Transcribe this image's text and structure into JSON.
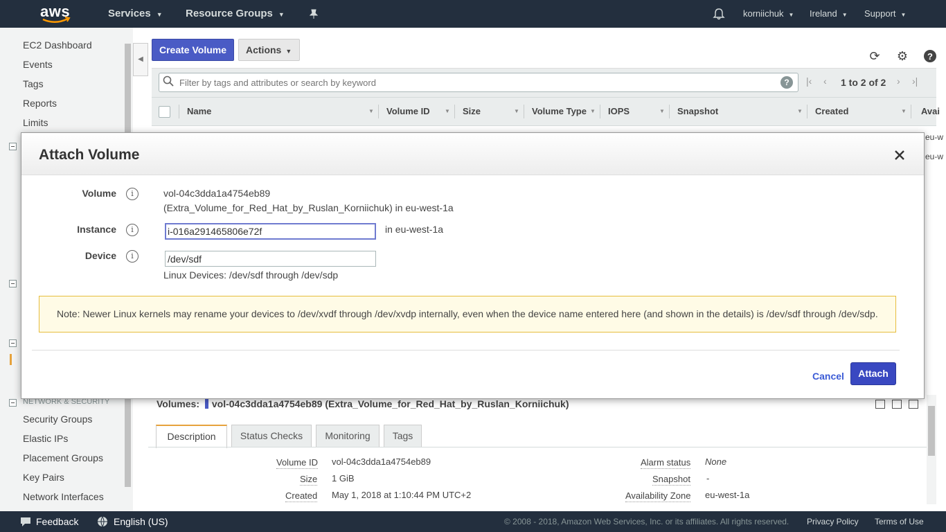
{
  "topnav": {
    "logo": "aws",
    "services": "Services",
    "resource_groups": "Resource Groups",
    "user": "korniichuk",
    "region": "Ireland",
    "support": "Support"
  },
  "sidebar": {
    "items_top": [
      "EC2 Dashboard",
      "Events",
      "Tags",
      "Reports",
      "Limits"
    ],
    "network_section": "NETWORK & SECURITY",
    "network_items": [
      "Security Groups",
      "Elastic IPs",
      "Placement Groups",
      "Key Pairs",
      "Network Interfaces"
    ]
  },
  "toolbar": {
    "create_label": "Create Volume",
    "actions_label": "Actions"
  },
  "filter": {
    "placeholder": "Filter by tags and attributes or search by keyword",
    "pager": "1 to 2 of 2"
  },
  "table": {
    "columns": [
      "Name",
      "Volume ID",
      "Size",
      "Volume Type",
      "IOPS",
      "Snapshot",
      "Created",
      "Avai"
    ],
    "az_partial": [
      "eu-w",
      "eu-w"
    ]
  },
  "details": {
    "header_prefix": "Volumes:",
    "header_value": "vol-04c3dda1a4754eb89 (Extra_Volume_for_Red_Hat_by_Ruslan_Korniichuk)",
    "tabs": [
      "Description",
      "Status Checks",
      "Monitoring",
      "Tags"
    ],
    "left": [
      {
        "label": "Volume ID",
        "value": "vol-04c3dda1a4754eb89"
      },
      {
        "label": "Size",
        "value": "1 GiB"
      },
      {
        "label": "Created",
        "value": "May 1, 2018 at 1:10:44 PM UTC+2"
      }
    ],
    "right": [
      {
        "label": "Alarm status",
        "value": "None"
      },
      {
        "label": "Snapshot",
        "value": "-"
      },
      {
        "label": "Availability Zone",
        "value": "eu-west-1a"
      }
    ]
  },
  "modal": {
    "title": "Attach Volume",
    "volume_label": "Volume",
    "volume_id": "vol-04c3dda1a4754eb89",
    "volume_desc": "(Extra_Volume_for_Red_Hat_by_Ruslan_Korniichuk) in eu-west-1a",
    "instance_label": "Instance",
    "instance_value": "i-016a291465806e72f",
    "instance_az": "in eu-west-1a",
    "device_label": "Device",
    "device_value": "/dev/sdf",
    "device_hint": "Linux Devices: /dev/sdf through /dev/sdp",
    "note": "Note: Newer Linux kernels may rename your devices to /dev/xvdf through /dev/xvdp internally, even when the device name entered here (and shown in the details) is /dev/sdf through /dev/sdp.",
    "cancel": "Cancel",
    "attach": "Attach"
  },
  "footer": {
    "feedback": "Feedback",
    "language": "English (US)",
    "copyright": "© 2008 - 2018, Amazon Web Services, Inc. or its affiliates. All rights reserved.",
    "privacy": "Privacy Policy",
    "terms": "Terms of Use"
  },
  "colors": {
    "nav_bg": "#232f3e",
    "primary": "#4a5bc5",
    "accent": "#e6a23c"
  }
}
